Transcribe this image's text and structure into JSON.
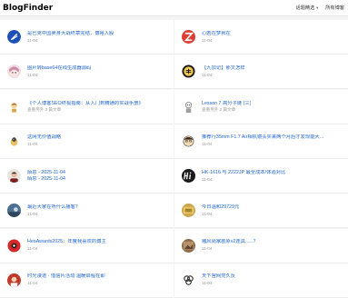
{
  "header": {
    "logo": "BlogFinder",
    "menu_label": "话题精选",
    "all_blogs_label": "所有博客"
  },
  "left": [
    {
      "title": "是巴克中国卖身大战终章完结，博裕入股",
      "date": "11-04",
      "icon": "swoosh-logo-icon"
    },
    {
      "title": "图片转base64在线生成器源码",
      "date": "11-04",
      "icon": "anime-avatar-icon"
    },
    {
      "title": "《个人博客SEO终极指南：从入门到精通的实战手册》",
      "sub": "查看另外 3 篇文章",
      "icon": "character-avatar-icon"
    },
    {
      "title": "这网无价值战略",
      "date": "11-04",
      "icon": "bird-avatar-icon"
    },
    {
      "title": "陌思 - 2025-11-04",
      "sub": "陌思 - 2025-11-04",
      "icon": "man-photo-icon"
    },
    {
      "title": "最近大家在听什么播客？",
      "date": "11-04",
      "icon": "blue-photo-icon"
    },
    {
      "title": "HeoAwards2025：年度我喜欢的博主",
      "date": "11-04",
      "icon": "red-logo-icon"
    },
    {
      "title": "时光漫道 · 惜信片活动 温暖启程在即",
      "date": "11-04",
      "icon": "red-photo-icon"
    }
  ],
  "right": [
    {
      "title": "心若在梦就在",
      "date": "11-04",
      "icon": "red-z-logo-icon"
    },
    {
      "title": "【九加记】那又怎样",
      "date": "11-04",
      "icon": "coin-emblem-icon"
    },
    {
      "title": "Lesson 7 高分子链 (三)",
      "sub": "查看另外 2 篇文章",
      "icon": "cartoon-avatar-icon"
    },
    {
      "title": "推荐行35mm F1.7 Air相机镜头买来两个月后才发现能大...",
      "date": "11-04",
      "icon": "cartoon-face-icon"
    },
    {
      "title": "HK-1616 与 2222JP 最全成本/体验对比",
      "date": "11-04",
      "icon": "hi-logo-icon"
    },
    {
      "title": "今日温和29729元",
      "date": "11-04",
      "icon": "gold-photo-icon"
    },
    {
      "title": "赌风尚家剧原v2连具......？",
      "date": "11-04",
      "icon": "brown-photo-icon"
    },
    {
      "title": "天下宫网党久反",
      "date": "11-04",
      "icon": "knot-logo-icon"
    }
  ]
}
